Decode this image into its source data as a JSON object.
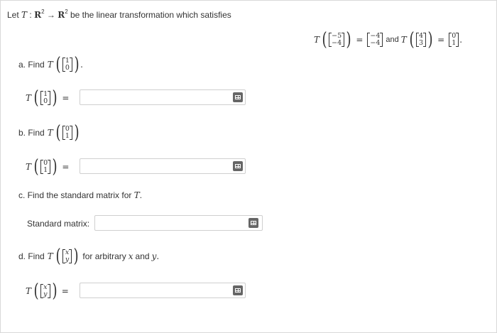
{
  "intro": {
    "prefix": "Let",
    "T": "T",
    "colon": ":",
    "space": "R",
    "exp": "2",
    "arrow": "→",
    "suffix": "be the linear transformation which satisfies"
  },
  "given": {
    "T": "T",
    "v1": [
      "−5",
      "−4"
    ],
    "w1": [
      "−4",
      "−4"
    ],
    "and": "and",
    "v2": [
      "4",
      "3"
    ],
    "w2": [
      "0",
      "1"
    ],
    "eq": "=",
    "period": "."
  },
  "parts": {
    "a": {
      "label": "a. Find",
      "T": "T",
      "vec": [
        "1",
        "0"
      ],
      "period": "."
    },
    "b": {
      "label": "b. Find",
      "T": "T",
      "vec": [
        "0",
        "1"
      ]
    },
    "c": {
      "label": "c. Find the standard matrix for",
      "T": "T",
      "period": "."
    },
    "d": {
      "label": "d. Find",
      "T": "T",
      "vec": [
        "x",
        "y"
      ],
      "tail1": "for arbitrary",
      "x": "x",
      "tail2": "and",
      "y": "y",
      "period": "."
    }
  },
  "answers": {
    "a": {
      "T": "T",
      "vec": [
        "1",
        "0"
      ],
      "eq": "=",
      "value": ""
    },
    "b": {
      "T": "T",
      "vec": [
        "0",
        "1"
      ],
      "eq": "=",
      "value": ""
    },
    "c": {
      "label": "Standard matrix:",
      "value": ""
    },
    "d": {
      "T": "T",
      "vec": [
        "x",
        "y"
      ],
      "eq": "=",
      "value": ""
    }
  },
  "icons": {
    "matrix_button": "matrix-grid-icon"
  }
}
